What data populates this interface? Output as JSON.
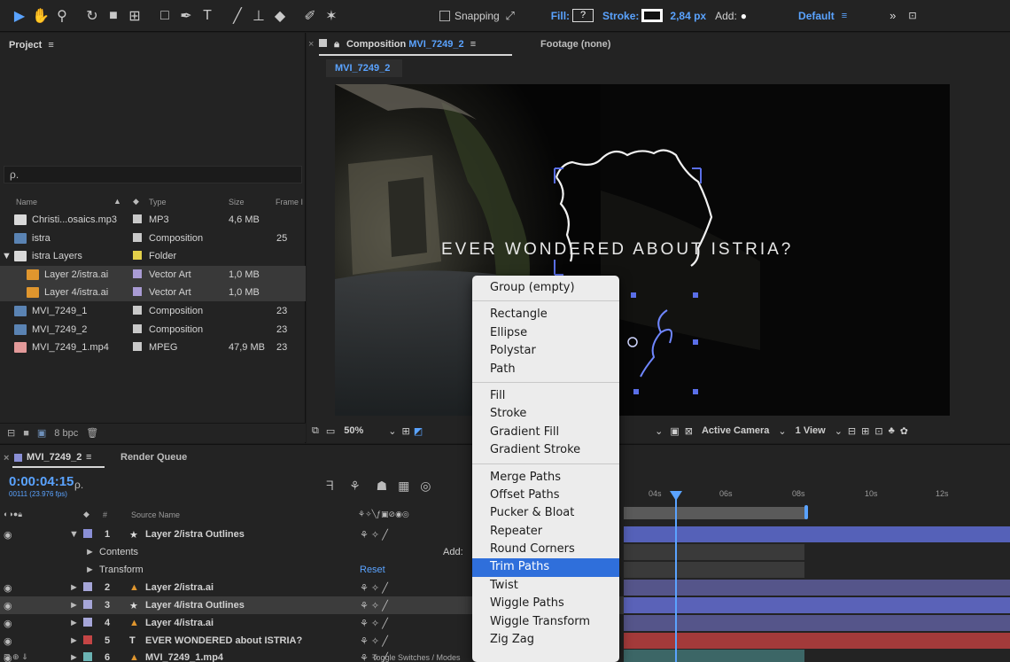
{
  "toolbar": {
    "snapping_label": "Snapping",
    "fill_label": "Fill:",
    "fill_value": "?",
    "stroke_label": "Stroke:",
    "stroke_width": "2,84 px",
    "add_label": "Add:",
    "workspace": "Default",
    "overflow": "»"
  },
  "project": {
    "title": "Project",
    "search_placeholder": "ρ.",
    "columns": {
      "name": "Name",
      "type": "Type",
      "size": "Size",
      "frame": "Frame I"
    },
    "items": [
      {
        "name": "Christi...osaics.mp3",
        "type": "MP3",
        "size": "4,6 MB",
        "frame": "",
        "icon_color": "#d9d9d9",
        "swatch": "#c9c9c9"
      },
      {
        "name": "istra",
        "type": "Composition",
        "size": "",
        "frame": "25",
        "icon_color": "#5a83b3",
        "swatch": "#c9c9c9"
      },
      {
        "name": "istra Layers",
        "type": "Folder",
        "size": "",
        "frame": "",
        "icon_color": "#d9d9d9",
        "swatch": "#e3d04a"
      },
      {
        "name": "Layer 2/istra.ai",
        "type": "Vector Art",
        "size": "1,0 MB",
        "frame": "",
        "icon_color": "#e0962e",
        "swatch": "#a99bd4"
      },
      {
        "name": "Layer 4/istra.ai",
        "type": "Vector Art",
        "size": "1,0 MB",
        "frame": "",
        "icon_color": "#e0962e",
        "swatch": "#a99bd4"
      },
      {
        "name": "MVI_7249_1",
        "type": "Composition",
        "size": "",
        "frame": "23",
        "icon_color": "#5a83b3",
        "swatch": "#c9c9c9"
      },
      {
        "name": "MVI_7249_2",
        "type": "Composition",
        "size": "",
        "frame": "23",
        "icon_color": "#5a83b3",
        "swatch": "#c9c9c9"
      },
      {
        "name": "MVI_7249_1.mp4",
        "type": "MPEG",
        "size": "47,9 MB",
        "frame": "23",
        "icon_color": "#e39a9a",
        "swatch": "#c9c9c9"
      }
    ],
    "bpc": "8 bpc"
  },
  "composition": {
    "tab_prefix": "Composition",
    "tab_name": "MVI_7249_2",
    "footage_tab": "Footage (none)",
    "subtab": "MVI_7249_2",
    "viewer_text": "EVER WONDERED ABOUT ISTRIA?",
    "zoom": "50%",
    "camera": "Active Camera",
    "view": "1 View"
  },
  "timeline": {
    "tab": "MVI_7249_2",
    "render_queue": "Render Queue",
    "timecode": "0:00:04:15",
    "fps": "00111 (23.976 fps)",
    "search_placeholder": "ρ.",
    "source_name_header": "Source Name",
    "layers": [
      {
        "num": "1",
        "name": "Layer 2/istra Outlines",
        "swatch": "#8a8fd6",
        "glyph": "★"
      },
      {
        "num": "",
        "name": "Contents",
        "swatch": "",
        "glyph": "►"
      },
      {
        "num": "",
        "name": "Transform",
        "swatch": "",
        "glyph": "►"
      },
      {
        "num": "2",
        "name": "Layer 2/istra.ai",
        "swatch": "#a6a6d8",
        "glyph": "▲"
      },
      {
        "num": "3",
        "name": "Layer 4/istra Outlines",
        "swatch": "#a6a6d8",
        "glyph": "★"
      },
      {
        "num": "4",
        "name": "Layer 4/istra.ai",
        "swatch": "#a6a6d8",
        "glyph": "▲"
      },
      {
        "num": "5",
        "name": "EVER WONDERED about ISTRIA?",
        "swatch": "#c44545",
        "glyph": "T"
      },
      {
        "num": "6",
        "name": "MVI_7249_1.mp4",
        "swatch": "#6bb3b3",
        "glyph": "▲"
      }
    ],
    "add_label": "Add:",
    "reset_label": "Reset",
    "ticks": [
      "04s",
      "06s",
      "08s",
      "10s",
      "12s"
    ],
    "footer": "Toggle Switches / Modes"
  },
  "context_menu": {
    "groups": [
      [
        "Group (empty)"
      ],
      [
        "Rectangle",
        "Ellipse",
        "Polystar",
        "Path"
      ],
      [
        "Fill",
        "Stroke",
        "Gradient Fill",
        "Gradient Stroke"
      ],
      [
        "Merge Paths",
        "Offset Paths",
        "Pucker & Bloat",
        "Repeater",
        "Round Corners",
        "Trim Paths",
        "Twist",
        "Wiggle Paths",
        "Wiggle Transform",
        "Zig Zag"
      ]
    ],
    "highlighted": "Trim Paths"
  }
}
